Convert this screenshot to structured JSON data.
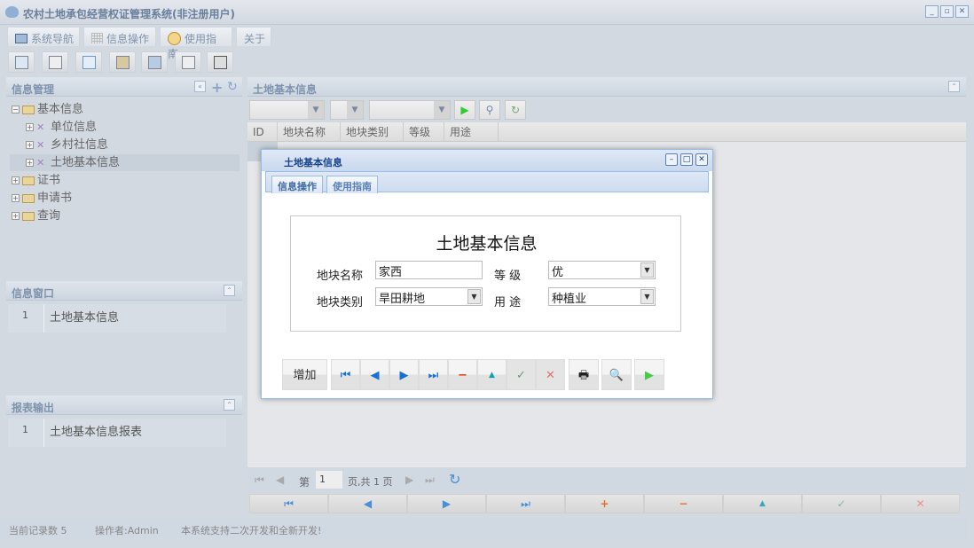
{
  "app": {
    "title": "农村土地承包经营权证管理系统(非注册用户)"
  },
  "menu_tabs": [
    {
      "label": "系统导航",
      "icon": "monitor-icon"
    },
    {
      "label": "信息操作",
      "icon": "grid-icon"
    },
    {
      "label": "使用指南",
      "icon": "help-icon"
    },
    {
      "label": "关于"
    }
  ],
  "toolbar_icons": [
    "search-icon",
    "list-icon",
    "document-icon",
    "user-computer-icon",
    "monitor-globe-icon",
    "window-add-icon",
    "window-icon"
  ],
  "left": {
    "info_manage": {
      "title": "信息管理",
      "tree": [
        {
          "label": "基本信息",
          "children": [
            "单位信息",
            "乡村社信息",
            "土地基本信息"
          ]
        },
        {
          "label": "证书"
        },
        {
          "label": "申请书"
        },
        {
          "label": "查询"
        }
      ]
    },
    "info_window": {
      "title": "信息窗口",
      "items": [
        {
          "num": "1",
          "label": "土地基本信息"
        }
      ]
    },
    "report": {
      "title": "报表输出",
      "items": [
        {
          "num": "1",
          "label": "土地基本信息报表"
        }
      ]
    }
  },
  "main": {
    "title": "土地基本信息",
    "columns": [
      "ID",
      "地块名称",
      "地块类别",
      "等级",
      "用途"
    ],
    "pager": {
      "page_prefix": "第",
      "page": "1",
      "page_suffix": "页,共 1 页"
    },
    "bottom_buttons": [
      "first",
      "prev",
      "next",
      "last",
      "add",
      "remove",
      "up",
      "confirm",
      "cancel"
    ]
  },
  "dialog": {
    "title": "土地基本信息",
    "tabs": [
      "信息操作",
      "使用指南"
    ],
    "form_title": "土地基本信息",
    "fields": {
      "name_label": "地块名称",
      "name_value": "家西",
      "grade_label": "等 级",
      "grade_value": "优",
      "type_label": "地块类别",
      "type_value": "旱田耕地",
      "use_label": "用 途",
      "use_value": "种植业"
    },
    "add_label": "增加"
  },
  "status": {
    "records": "当前记录数 5",
    "operator": "操作者:Admin",
    "notice": "本系统支持二次开发和全新开发!"
  },
  "colors": {
    "accent": "#15428b",
    "panel_bg": "#d3d9e1",
    "dialog_border": "#99bbe8"
  }
}
